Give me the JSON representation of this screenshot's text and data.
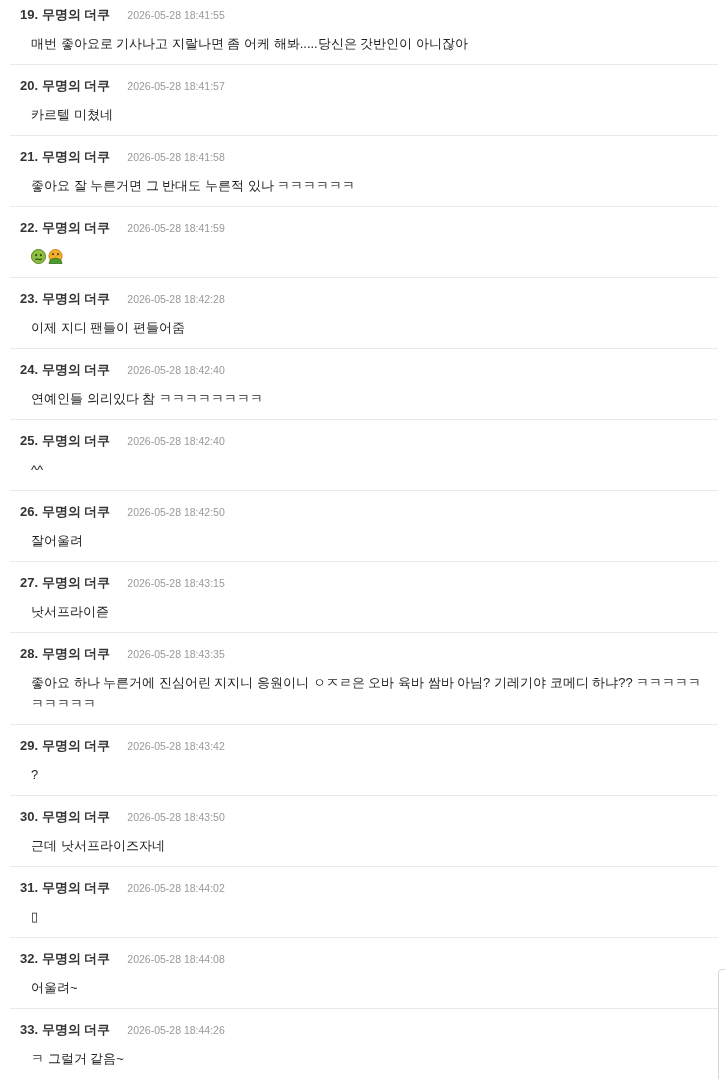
{
  "comments": [
    {
      "title": "19. 무명의 더쿠",
      "time": "2026-05-28 18:41:55",
      "body": "매번 좋아요로 기사나고 지랄나면 좀 어케 해봐.....당신은 갓반인이 아니잖아"
    },
    {
      "title": "20. 무명의 더쿠",
      "time": "2026-05-28 18:41:57",
      "body": "카르텔 미쳤네"
    },
    {
      "title": "21. 무명의 더쿠",
      "time": "2026-05-28 18:41:58",
      "body": "좋아요 잘 누른거면 그 반대도 누른적 있나 ㅋㅋㅋㅋㅋㅋ"
    },
    {
      "title": "22. 무명의 더쿠",
      "time": "2026-05-28 18:41:59",
      "body_icons": [
        {
          "kind": "nauseated"
        },
        {
          "kind": "vomiting"
        }
      ]
    },
    {
      "title": "23. 무명의 더쿠",
      "time": "2026-05-28 18:42:28",
      "body": "이제 지디 팬들이 편들어줌"
    },
    {
      "title": "24. 무명의 더쿠",
      "time": "2026-05-28 18:42:40",
      "body": "연예인들 의리있다 참 ㅋㅋㅋㅋㅋㅋㅋㅋ"
    },
    {
      "title": "25. 무명의 더쿠",
      "time": "2026-05-28 18:42:40",
      "body": "^^"
    },
    {
      "title": "26. 무명의 더쿠",
      "time": "2026-05-28 18:42:50",
      "body": "잘어울려"
    },
    {
      "title": "27. 무명의 더쿠",
      "time": "2026-05-28 18:43:15",
      "body": "낫서프라이즏"
    },
    {
      "title": "28. 무명의 더쿠",
      "time": "2026-05-28 18:43:35",
      "body": "좋아요 하나 누른거에 진심어린 지지니 응원이니 ㅇㅈㄹ은 오바 육바 쌈바 아님? 기레기야 코메디 하냐?? ㅋㅋㅋㅋㅋㅋㅋㅋㅋㅋ"
    },
    {
      "title": "29. 무명의 더쿠",
      "time": "2026-05-28 18:43:42",
      "body": "?"
    },
    {
      "title": "30. 무명의 더쿠",
      "time": "2026-05-28 18:43:50",
      "body": "근데 낫서프라이즈자네"
    },
    {
      "title": "31. 무명의 더쿠",
      "time": "2026-05-28 18:44:02",
      "body": "▯"
    },
    {
      "title": "32. 무명의 더쿠",
      "time": "2026-05-28 18:44:08",
      "body": "어울려~"
    },
    {
      "title": "33. 무명의 더쿠",
      "time": "2026-05-28 18:44:26",
      "body": "ㅋ 그럴거 같음~"
    }
  ]
}
